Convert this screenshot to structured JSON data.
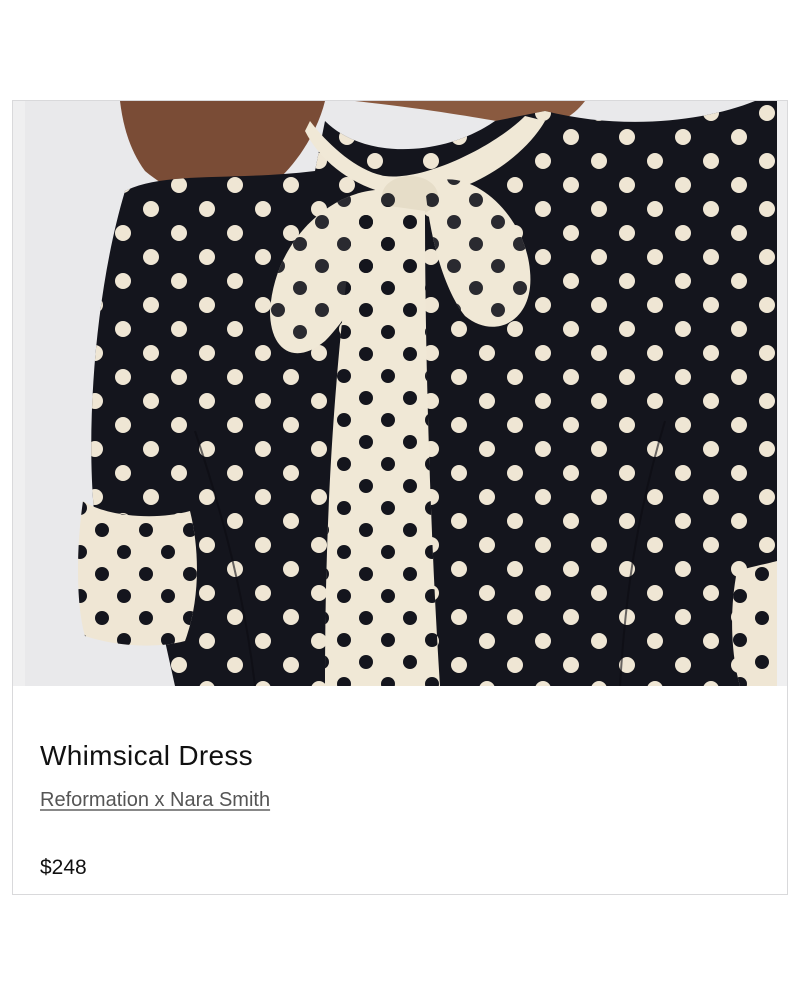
{
  "product": {
    "image_alt": "Black polka dot dress with cream polka dot tie-neck bow",
    "title": "Whimsical Dress",
    "brand": "Reformation x Nara Smith",
    "price": "$248"
  },
  "colors": {
    "fabric_dark": "#14151d",
    "dot_cream": "#efe6d4",
    "bow_cream": "#f0e8d6",
    "hair": "#7a4c36",
    "background": "#e8e8ea"
  }
}
